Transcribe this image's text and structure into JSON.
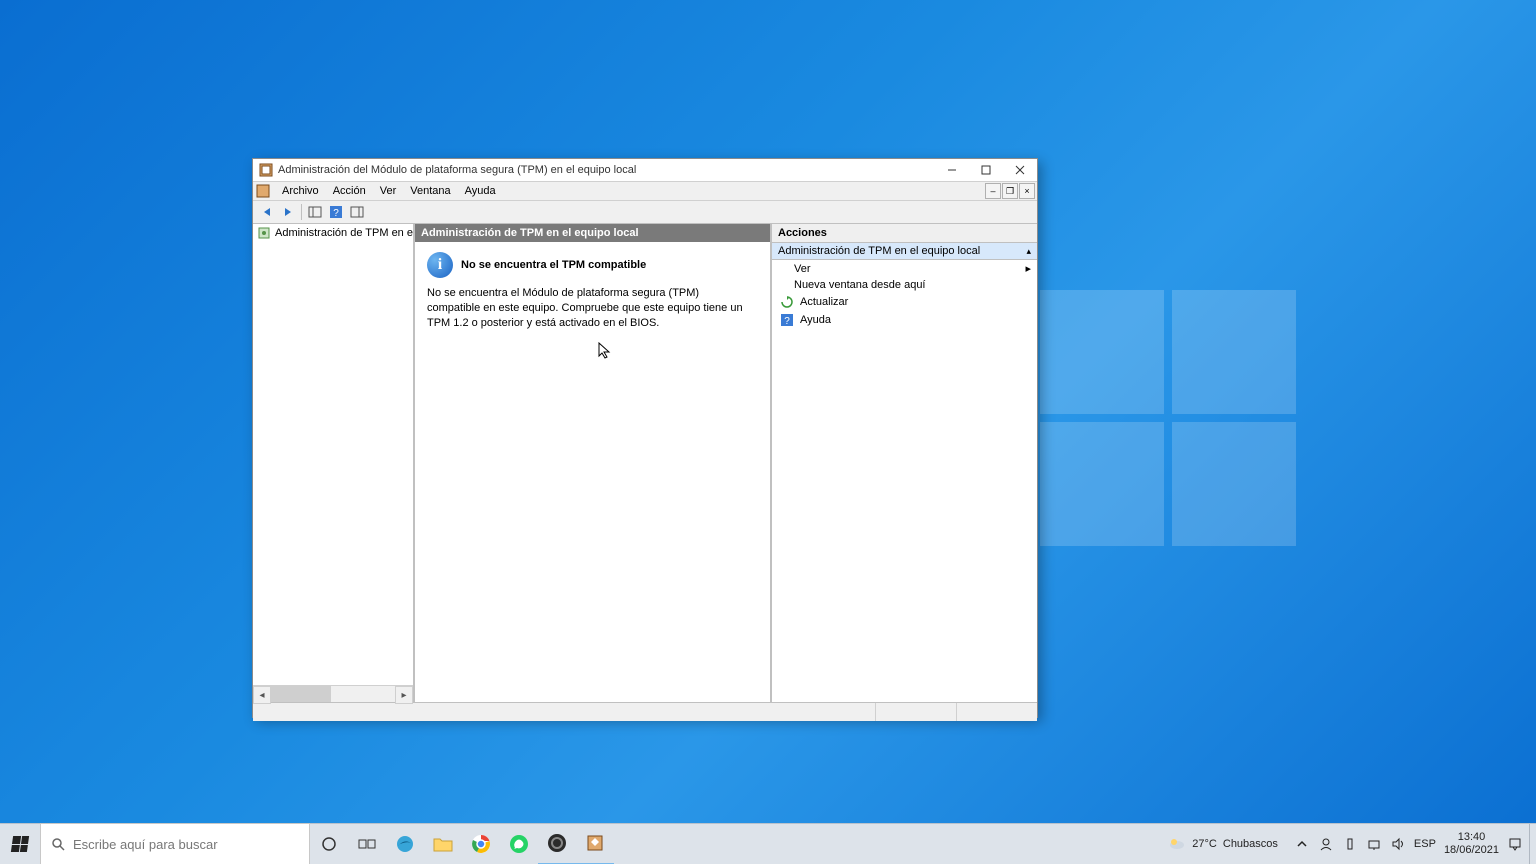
{
  "window": {
    "title": "Administración del Módulo de plataforma segura (TPM) en el equipo local",
    "menu": {
      "file": "Archivo",
      "action": "Acción",
      "view": "Ver",
      "window": "Ventana",
      "help": "Ayuda"
    },
    "tree_item": "Administración de TPM en el equip",
    "center_header": "Administración de TPM en el equipo local",
    "message_title": "No se encuentra el TPM compatible",
    "message_body": "No se encuentra el Módulo de plataforma segura (TPM) compatible en este equipo. Compruebe que este equipo tiene un TPM 1.2 o posterior y está activado en el BIOS."
  },
  "actions": {
    "header": "Acciones",
    "group": "Administración de TPM en el equipo local",
    "items": {
      "view": "Ver",
      "new_window": "Nueva ventana desde aquí",
      "refresh": "Actualizar",
      "help": "Ayuda"
    }
  },
  "taskbar": {
    "search_placeholder": "Escribe aquí para buscar",
    "weather_temp": "27°C",
    "weather_cond": "Chubascos",
    "lang": "ESP",
    "time": "13:40",
    "date": "18/06/2021"
  }
}
